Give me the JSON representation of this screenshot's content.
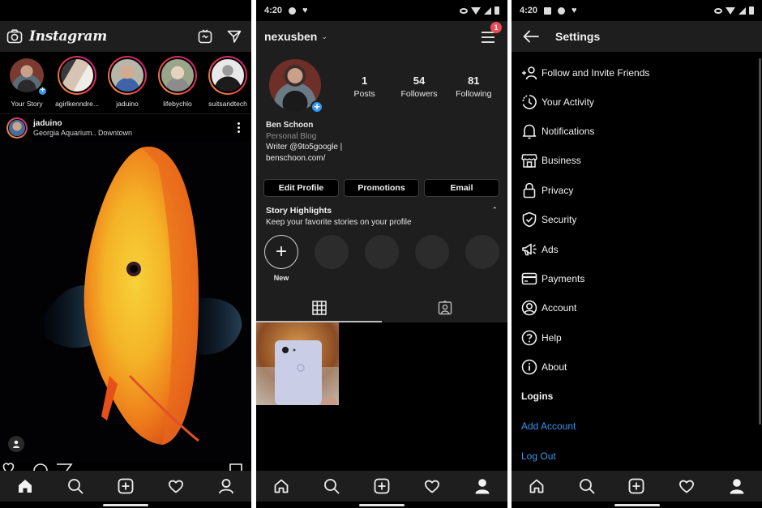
{
  "feed_screen": {
    "app_logo": "Instagram",
    "header_icons": [
      "camera-icon",
      "igtv-icon",
      "direct-message-icon"
    ],
    "stories": [
      {
        "username": "Your Story",
        "own": true
      },
      {
        "username": "agirlkenndre...",
        "own": false
      },
      {
        "username": "jaduino",
        "own": false
      },
      {
        "username": "lifebychlo",
        "own": false
      },
      {
        "username": "suitsandtech",
        "own": false
      }
    ],
    "post": {
      "username": "jaduino",
      "location": "Georgia Aquarium.. Downtown",
      "image_description": "Yellow-orange discus fish on black background"
    },
    "bottom_nav": [
      "home-icon",
      "search-icon",
      "new-post-icon",
      "activity-heart-icon",
      "profile-icon"
    ],
    "active_tab": "home"
  },
  "profile_screen": {
    "status_bar": {
      "time": "4:20"
    },
    "username": "nexusben",
    "notification_count": "1",
    "stats": [
      {
        "value": "1",
        "label": "Posts"
      },
      {
        "value": "54",
        "label": "Followers"
      },
      {
        "value": "81",
        "label": "Following"
      }
    ],
    "bio": {
      "name": "Ben Schoon",
      "category": "Personal Blog",
      "line1": "Writer @9to5google |",
      "line2": "benschoon.com/"
    },
    "buttons": {
      "edit_profile": "Edit Profile",
      "promotions": "Promotions",
      "email": "Email"
    },
    "story_highlights": {
      "title": "Story Highlights",
      "subtitle": "Keep your favorite stories on your profile",
      "new_label": "New",
      "placeholder_count": 4
    },
    "tabs": [
      "grid-icon",
      "tagged-icon"
    ],
    "active_tab": "grid",
    "bottom_nav": [
      "home-icon",
      "search-icon",
      "new-post-icon",
      "activity-heart-icon",
      "profile-icon"
    ],
    "active_nav": "profile"
  },
  "settings_screen": {
    "status_bar": {
      "time": "4:20"
    },
    "title": "Settings",
    "items": [
      {
        "label": "Follow and Invite Friends",
        "icon": "add-person-icon"
      },
      {
        "label": "Your Activity",
        "icon": "activity-clock-icon"
      },
      {
        "label": "Notifications",
        "icon": "bell-icon"
      },
      {
        "label": "Business",
        "icon": "shop-icon"
      },
      {
        "label": "Privacy",
        "icon": "lock-icon"
      },
      {
        "label": "Security",
        "icon": "shield-icon"
      },
      {
        "label": "Ads",
        "icon": "megaphone-icon"
      },
      {
        "label": "Payments",
        "icon": "credit-card-icon"
      },
      {
        "label": "Account",
        "icon": "account-circle-icon"
      },
      {
        "label": "Help",
        "icon": "help-icon"
      },
      {
        "label": "About",
        "icon": "info-icon"
      }
    ],
    "logins_section": "Logins",
    "add_account": "Add Account",
    "log_out": "Log Out",
    "accent_color": "#3897f0",
    "bottom_nav": [
      "home-icon",
      "search-icon",
      "new-post-icon",
      "activity-heart-icon",
      "profile-icon"
    ],
    "active_nav": "profile"
  }
}
